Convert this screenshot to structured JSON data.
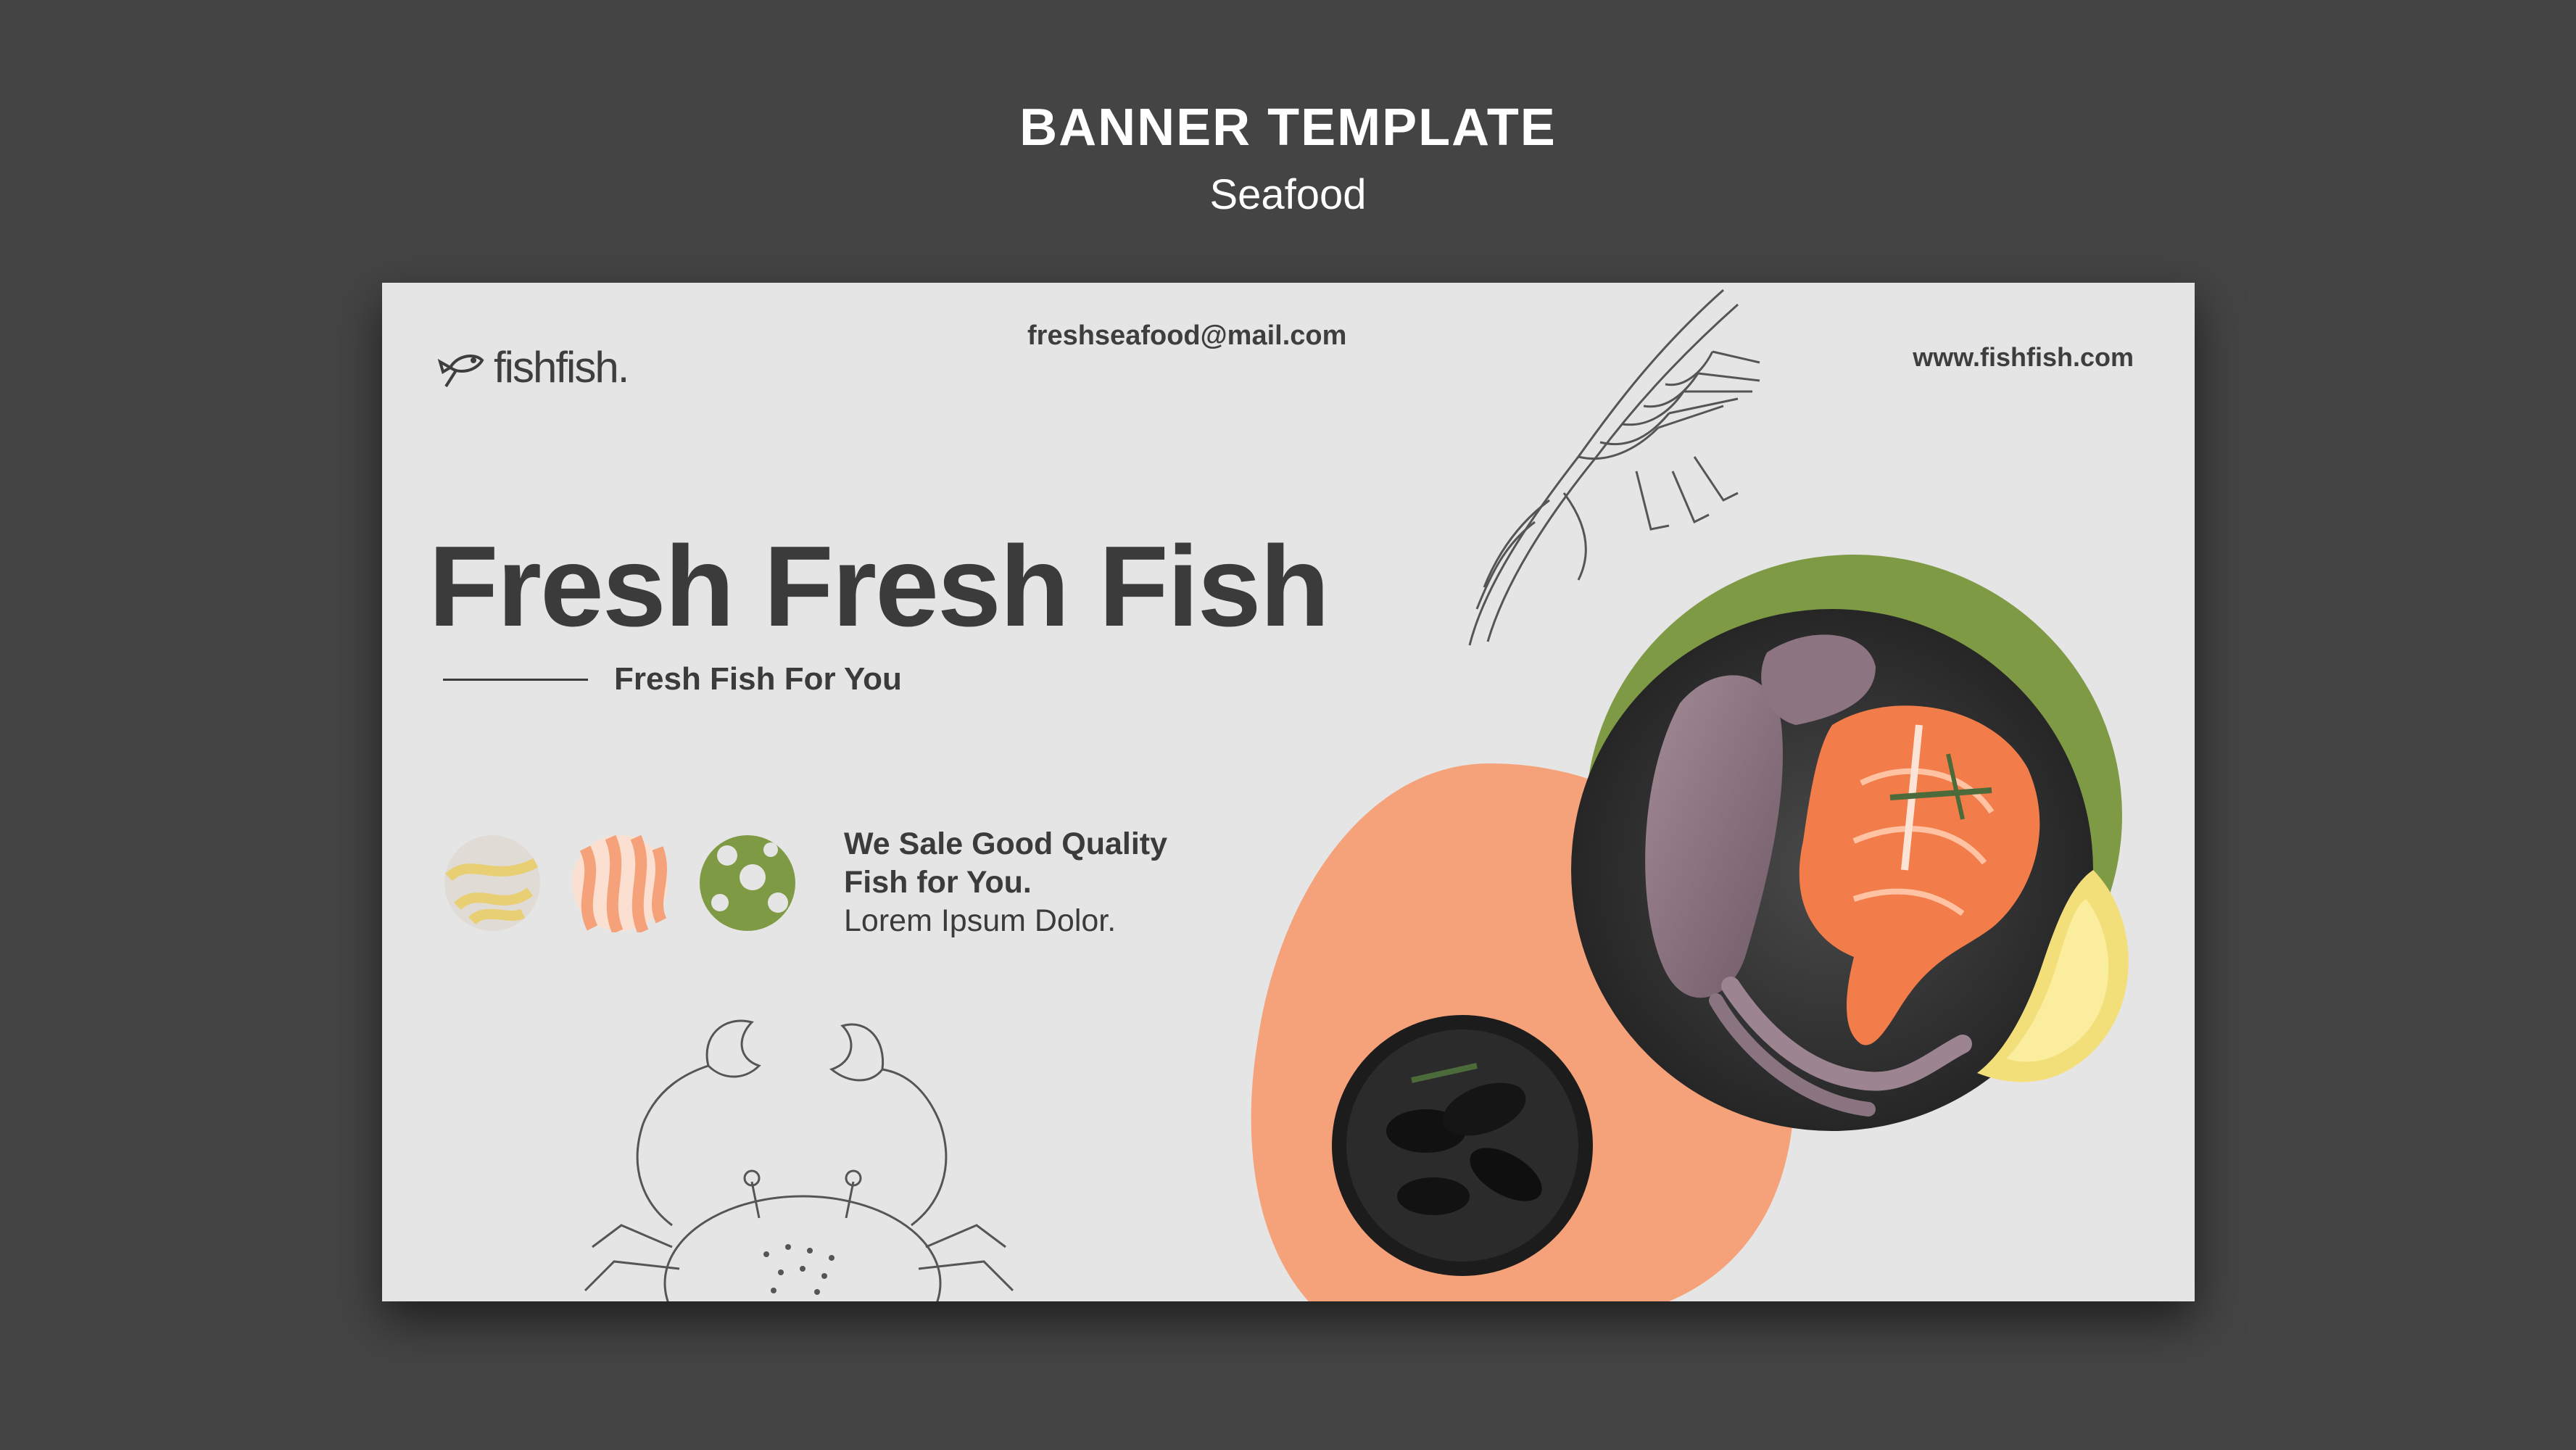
{
  "header": {
    "title": "BANNER TEMPLATE",
    "subtitle": "Seafood"
  },
  "banner": {
    "logo_text": "fishfish.",
    "email": "freshseafood@mail.com",
    "website": "www.fishfish.com",
    "headline": "Fresh Fresh Fish",
    "tagline": "Fresh Fish For You",
    "quality_line1": "We Sale Good Quality",
    "quality_line2": "Fish for You.",
    "quality_line3": "Lorem Ipsum Dolor."
  },
  "colors": {
    "background": "#444444",
    "banner": "#e6e5e5",
    "text": "#3b3b3b",
    "accent_orange": "#f5a27a",
    "accent_green": "#7f9a45",
    "accent_yellow": "#e8cf74"
  },
  "icons": [
    "fish-logo-icon",
    "yellow-pattern-swatch",
    "orange-stripe-swatch",
    "green-dot-swatch"
  ]
}
